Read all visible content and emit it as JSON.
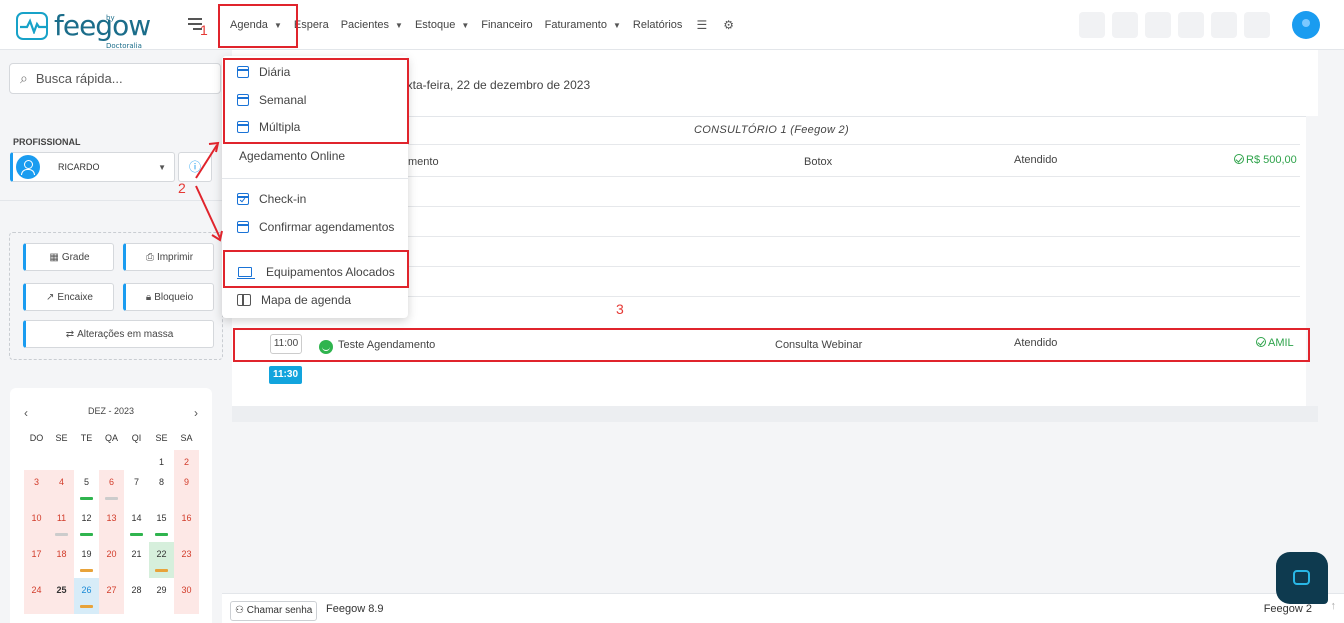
{
  "brand": {
    "name": "feegow",
    "by": "by Doctoralia"
  },
  "nav": {
    "items": [
      {
        "label": "Agenda",
        "caret": true
      },
      {
        "label": "Espera",
        "caret": false
      },
      {
        "label": "Pacientes",
        "caret": true
      },
      {
        "label": "Estoque",
        "caret": true
      },
      {
        "label": "Financeiro",
        "caret": false
      },
      {
        "label": "Faturamento",
        "caret": true
      },
      {
        "label": "Relatórios",
        "caret": false
      }
    ],
    "database_icon": "database-icon",
    "settings_icon": "gear-icon"
  },
  "annotations": {
    "n1": "1",
    "n2": "2",
    "n3": "3"
  },
  "search": {
    "placeholder": "Busca rápida..."
  },
  "profissional": {
    "label": "PROFISSIONAL",
    "selected": "RICARDO"
  },
  "actions": {
    "grade": "Grade",
    "imprimir": "Imprimir",
    "encaixe": "Encaixe",
    "bloqueio": "Bloqueio",
    "alteracoes": "Alterações em massa"
  },
  "calendar": {
    "month": "DEZ - 2023",
    "dow": [
      "DO",
      "SE",
      "TE",
      "QA",
      "QI",
      "SE",
      "SA"
    ],
    "weeks": [
      [
        "",
        "",
        "",
        "",
        "",
        "1",
        "2"
      ],
      [
        "3",
        "4",
        "5",
        "6",
        "7",
        "8",
        "9"
      ],
      [
        "10",
        "11",
        "12",
        "13",
        "14",
        "15",
        "16"
      ],
      [
        "17",
        "18",
        "19",
        "20",
        "21",
        "22",
        "23"
      ],
      [
        "24",
        "25",
        "26",
        "27",
        "28",
        "29",
        "30"
      ]
    ]
  },
  "main": {
    "date_title": "exta-feira, 22 de dezembro de 2023",
    "column_header": "CONSULTÓRIO 1 (Feegow 2)",
    "row1": {
      "name": "mento",
      "procedure": "Botox",
      "status": "Atendido",
      "value": "R$ 500,00"
    },
    "row2": {
      "time": "11:00",
      "name": "Teste Agendamento",
      "procedure": "Consulta Webinar",
      "status": "Atendido",
      "value": "AMIL"
    },
    "next_time": "11:30"
  },
  "dropdown": {
    "items": [
      {
        "label": "Diária",
        "icon": "calendar-day-icon"
      },
      {
        "label": "Semanal",
        "icon": "calendar-week-icon"
      },
      {
        "label": "Múltipla",
        "icon": "calendar-grid-icon"
      },
      {
        "label": "Agedamento Online",
        "icon": ""
      },
      {
        "label": "Check-in",
        "icon": "calendar-check-icon"
      },
      {
        "label": "Confirmar agendamentos",
        "icon": "calendar-confirm-icon"
      },
      {
        "label": "Equipamentos Alocados",
        "icon": "laptop-icon"
      },
      {
        "label": "Mapa de agenda",
        "icon": "map-icon"
      }
    ]
  },
  "footer": {
    "call_label": "Chamar senha",
    "version": "Feegow 8.9",
    "brand_right": "Feegow 2"
  },
  "colors": {
    "accent": "#1a9cf0",
    "annotation_red": "#e0242c",
    "success": "#2fa34b"
  }
}
